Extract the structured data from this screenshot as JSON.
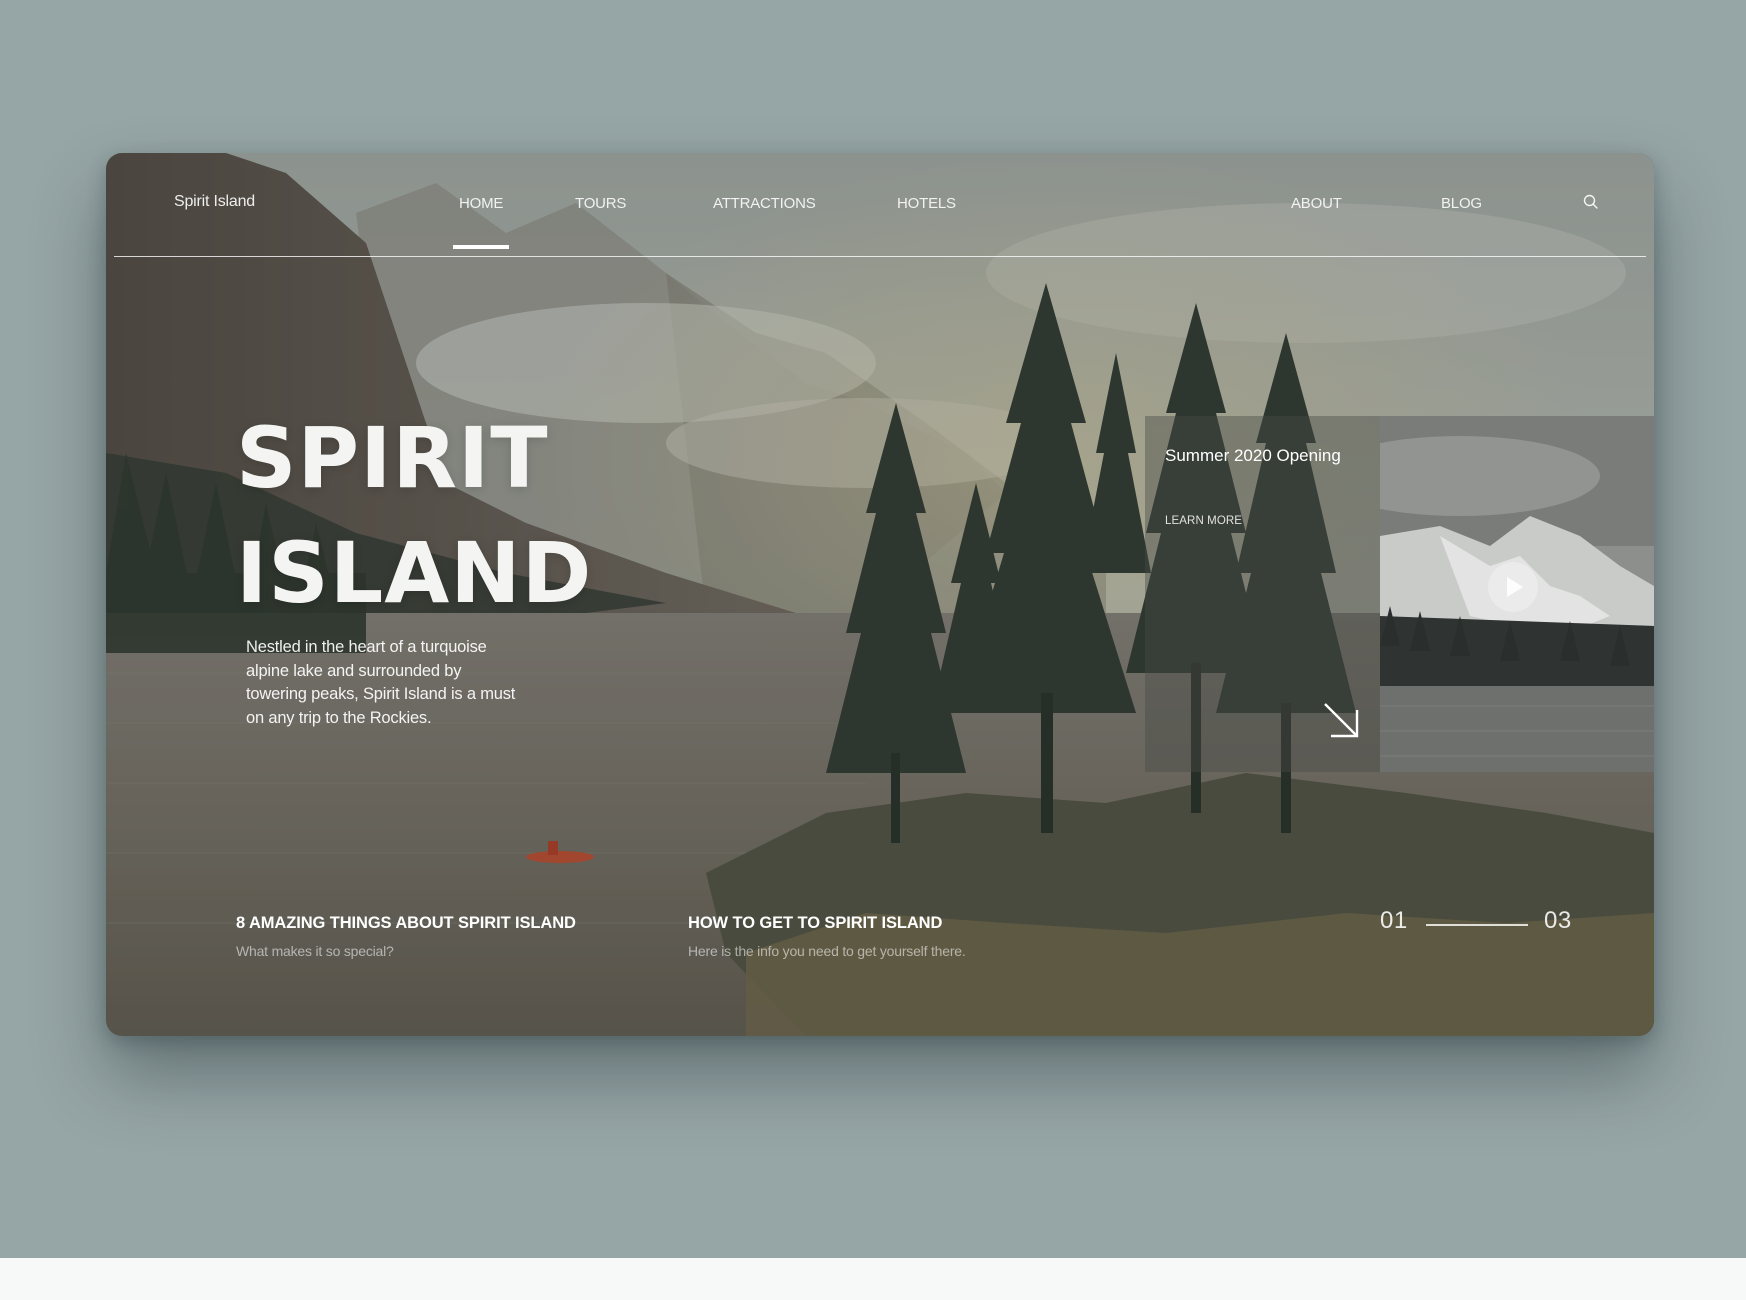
{
  "site": {
    "logo": "Spirit Island"
  },
  "nav": {
    "left": [
      {
        "label": "HOME",
        "active": true
      },
      {
        "label": "TOURS"
      },
      {
        "label": "ATTRACTIONS"
      },
      {
        "label": "HOTELS"
      }
    ],
    "right": [
      {
        "label": "ABOUT"
      },
      {
        "label": "BLOG"
      }
    ],
    "search_icon": "search-icon"
  },
  "hero": {
    "title_line1": "SPIRIT",
    "title_line2": "ISLAND",
    "description": "Nestled in the heart of a turquoise alpine lake and surrounded by towering peaks, Spirit Island is a must on any trip to the Rockies."
  },
  "feature": {
    "title": "Summer 2020 Opening",
    "link": "LEARN MORE",
    "arrow_icon": "arrow-down-right-icon",
    "video_icon": "play-icon"
  },
  "articles": [
    {
      "title": "8 AMAZING THINGS ABOUT SPIRIT ISLAND",
      "subtitle": "What makes it so special?"
    },
    {
      "title": "HOW TO GET TO SPIRIT ISLAND",
      "subtitle": "Here is the info you need to get yourself there."
    }
  ],
  "pager": {
    "current": "01",
    "total": "03"
  },
  "colors": {
    "page_background": "#96a5a6",
    "text_light": "#ffffff",
    "lake": "#6f6c63",
    "forest": "#2f3a30"
  }
}
